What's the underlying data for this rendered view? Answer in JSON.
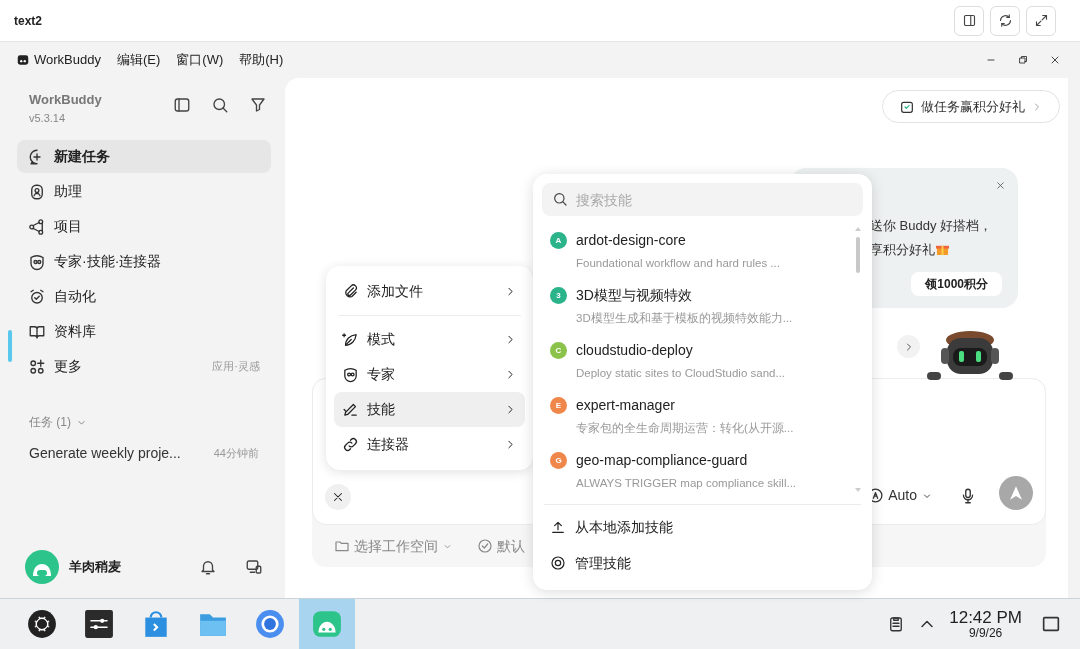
{
  "frame": {
    "title": "text2"
  },
  "menu_bar": {
    "app": "WorkBuddy",
    "items": [
      "编辑(E)",
      "窗口(W)",
      "帮助(H)"
    ]
  },
  "sidebar": {
    "app_name": "WorkBuddy",
    "version": "v5.3.14",
    "items": [
      {
        "kind": "new",
        "label": "新建任务",
        "selected": true
      },
      {
        "kind": "assistant",
        "label": "助理",
        "selected": false
      },
      {
        "kind": "project",
        "label": "项目",
        "selected": false
      },
      {
        "kind": "expert",
        "label": "专家·技能·连接器",
        "selected": false
      },
      {
        "kind": "automation",
        "label": "自动化",
        "selected": false
      },
      {
        "kind": "library",
        "label": "资料库",
        "selected": false
      },
      {
        "kind": "more",
        "label": "更多",
        "hint": "应用·灵感",
        "selected": false
      }
    ],
    "tasks_header": "任务 (1)",
    "tasks": [
      {
        "title": "Generate weekly proje...",
        "time": "44分钟前"
      }
    ],
    "user": {
      "name": "羊肉稍麦"
    }
  },
  "promo_chip": "做任务赢积分好礼",
  "promo_card": {
    "lines": [
      "送你 Buddy 好搭档，",
      "享积分好礼"
    ],
    "button": "领1000积分"
  },
  "composer": {
    "model": "Auto",
    "workspace": "选择工作空间",
    "default_label": "默认"
  },
  "add_menu": [
    {
      "kind": "file",
      "label": "添加文件",
      "selected": false
    },
    {
      "kind": "mode",
      "label": "模式",
      "selected": false
    },
    {
      "kind": "expert",
      "label": "专家",
      "selected": false
    },
    {
      "kind": "skill",
      "label": "技能",
      "selected": true
    },
    {
      "kind": "connector",
      "label": "连接器",
      "selected": false
    }
  ],
  "skills_menu": {
    "search": {
      "placeholder": "搜索技能"
    },
    "skills": [
      {
        "badge": "A",
        "color": "#2bb38a",
        "name": "ardot-design-core",
        "description": "Foundational workflow and hard rules ..."
      },
      {
        "badge": "3",
        "color": "#2bb38a",
        "name": "3D模型与视频特效",
        "description": "3D模型生成和基于模板的视频特效能力..."
      },
      {
        "badge": "C",
        "color": "#8bc34a",
        "name": "cloudstudio-deploy",
        "description": "Deploy static sites to CloudStudio sand..."
      },
      {
        "badge": "E",
        "color": "#f0874a",
        "name": "expert-manager",
        "description": "专家包的全生命周期运营：转化(从开源..."
      },
      {
        "badge": "G",
        "color": "#f0874a",
        "name": "geo-map-compliance-guard",
        "description": "ALWAYS TRIGGER map compliance skill..."
      }
    ],
    "actions": [
      {
        "kind": "upload",
        "label": "从本地添加技能"
      },
      {
        "kind": "manage",
        "label": "管理技能"
      }
    ]
  },
  "taskbar": {
    "apps": [
      {
        "kind": "launcher",
        "selected": false
      },
      {
        "kind": "settings",
        "selected": false
      },
      {
        "kind": "store",
        "selected": false
      },
      {
        "kind": "files",
        "selected": false
      },
      {
        "kind": "browser",
        "selected": false
      },
      {
        "kind": "workbuddy",
        "selected": true
      }
    ],
    "time": "12:42 PM",
    "date": "9/9/26"
  }
}
